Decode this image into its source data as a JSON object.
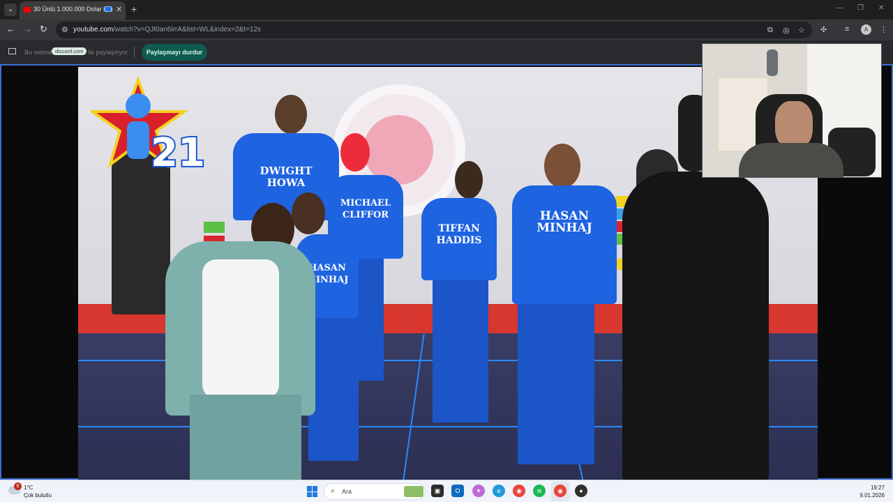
{
  "browser": {
    "tab_title": "30 Ünlü 1.000.000 Dolar için",
    "url_host": "youtube.com",
    "url_rest": "/watch?v=QJI0an6irrA&list=WL&index=2&t=12s",
    "profile_initial": "A"
  },
  "sharebar": {
    "prefix": "Bu sekme",
    "site": "discord.com",
    "suffix": "ile paylaşılıyor",
    "stop_label": "Paylaşmayı durdur"
  },
  "video": {
    "logo_number": "21",
    "jerseys": [
      "DWIGHT\nHOWA",
      "MICHAEL\nCLIFFOR",
      "TIFFAN\nHADDIS",
      "HASAN\nMINHAJ",
      "HASAN\nMINHAJ"
    ]
  },
  "taskbar": {
    "weather_badge": "6",
    "temperature": "1°C",
    "condition": "Çok bulutlu",
    "search_placeholder": "Ara",
    "time": "19:27",
    "date": "9.01.2026"
  }
}
